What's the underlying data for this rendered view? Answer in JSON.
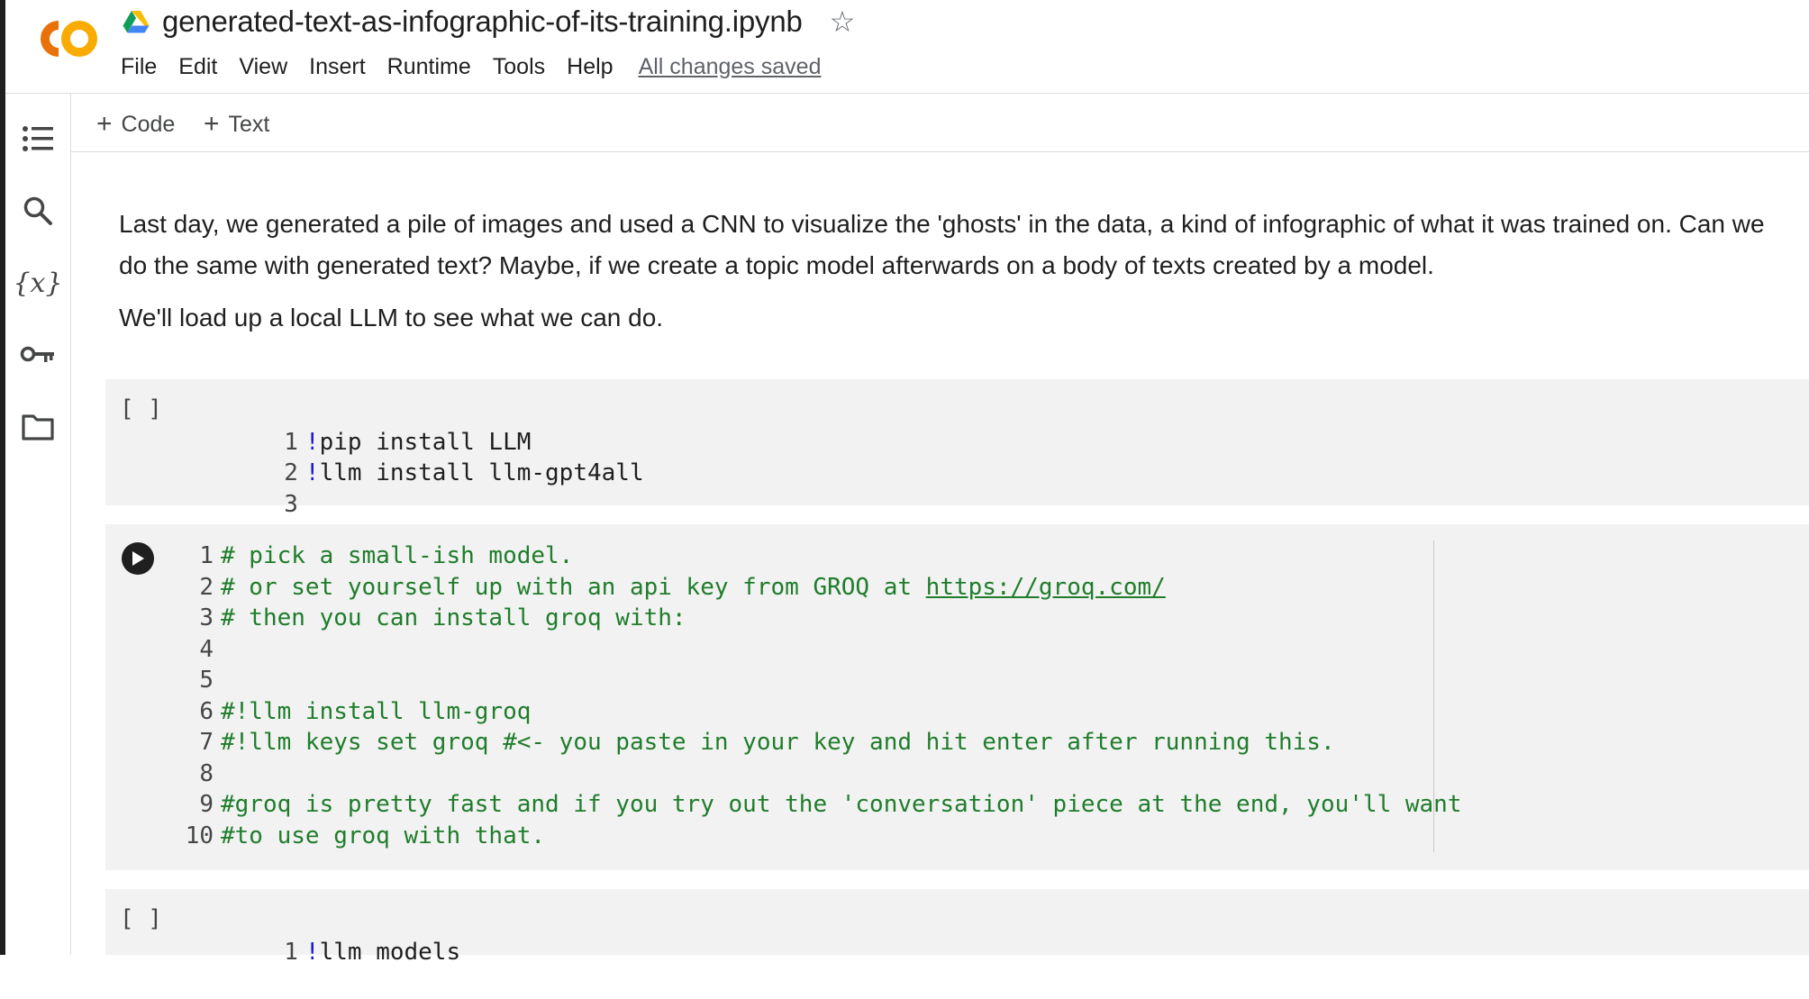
{
  "header": {
    "title": "generated-text-as-infographic-of-its-training.ipynb",
    "menu": [
      "File",
      "Edit",
      "View",
      "Insert",
      "Runtime",
      "Tools",
      "Help"
    ],
    "save_status": "All changes saved"
  },
  "toolbar": {
    "code_label": "Code",
    "text_label": "Text"
  },
  "sidebar": {
    "icons": [
      "table-of-contents-icon",
      "search-icon",
      "variables-icon",
      "secrets-key-icon",
      "files-folder-icon"
    ],
    "variables_glyph": "{x}"
  },
  "text_cell": {
    "paragraph1": "Last day, we generated a pile of images and used a CNN to visualize the 'ghosts' in the data, a kind of infographic of what it was trained on. Can we do the same with generated text? Maybe, if we create a topic model afterwards on a body of texts created by a model.",
    "paragraph2": "We'll load up a local LLM to see what we can do."
  },
  "cells": [
    {
      "bracket": "[ ]",
      "lines": [
        {
          "n": "1",
          "bang": "!",
          "text": "pip install LLM"
        },
        {
          "n": "2",
          "bang": "!",
          "text": "llm install llm-gpt4all"
        },
        {
          "n": "3",
          "bang": "",
          "text": ""
        }
      ]
    },
    {
      "lines": [
        {
          "n": "1",
          "text": "# pick a small-ish model."
        },
        {
          "n": "2",
          "text": "# or set yourself up with an api key from GROQ at ",
          "link": "https://groq.com/"
        },
        {
          "n": "3",
          "text": "# then you can install groq with:"
        },
        {
          "n": "4",
          "text": ""
        },
        {
          "n": "5",
          "text": ""
        },
        {
          "n": "6",
          "text": "#!llm install llm-groq"
        },
        {
          "n": "7",
          "text": "#!llm keys set groq #<- you paste in your key and hit enter after running this."
        },
        {
          "n": "8",
          "text": ""
        },
        {
          "n": "9",
          "text": "#groq is pretty fast and if you try out the 'conversation' piece at the end, you'll want"
        },
        {
          "n": "10",
          "text": "#to use groq with that."
        }
      ]
    },
    {
      "bracket": "[ ]",
      "lines": [
        {
          "n": "1",
          "bang": "!",
          "text": "llm models"
        }
      ]
    }
  ],
  "colors": {
    "logo_orange": "#F9AB00",
    "logo_deep_orange": "#E8710A",
    "comment_green": "#1F7D2B",
    "bang_blue": "#1A1ADA",
    "cell_background": "#F2F2F2"
  }
}
